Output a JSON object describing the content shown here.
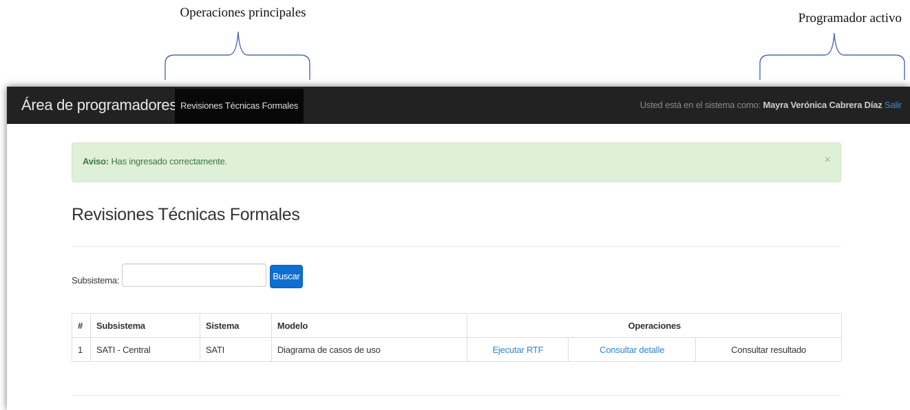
{
  "annotations": {
    "left_label": "Operaciones principales",
    "right_label": "Programador activo"
  },
  "navbar": {
    "brand": "Área de programadores",
    "active_item": "Revisiones Técnicas Formales",
    "user_prefix": "Usted está en el sistema como:",
    "user_name": "Mayra Verónica Cabrera Díaz",
    "logout": "Salir"
  },
  "alert": {
    "title": "Aviso:",
    "message": "Has ingresado correctamente.",
    "close": "×"
  },
  "page": {
    "title": "Revisiones Técnicas Formales"
  },
  "search": {
    "label": "Subsistema:",
    "value": "",
    "button": "Buscar"
  },
  "table": {
    "headers": [
      "#",
      "Subsistema",
      "Sistema",
      "Modelo",
      "Operaciones"
    ],
    "rows": [
      {
        "num": "1",
        "subsistema": "SATI - Central",
        "sistema": "SATI",
        "modelo": "Diagrama de casos de uso",
        "op_ejecutar": "Ejecutar RTF",
        "op_detalle": "Consultar detalle",
        "op_resultado": "Consultar resultado"
      }
    ]
  },
  "colors": {
    "navbar_bg": "#222222",
    "accent_blue": "#0e6fd2",
    "alert_bg": "#dff0d8",
    "alert_text": "#3c763d",
    "link": "#2f84cc"
  }
}
